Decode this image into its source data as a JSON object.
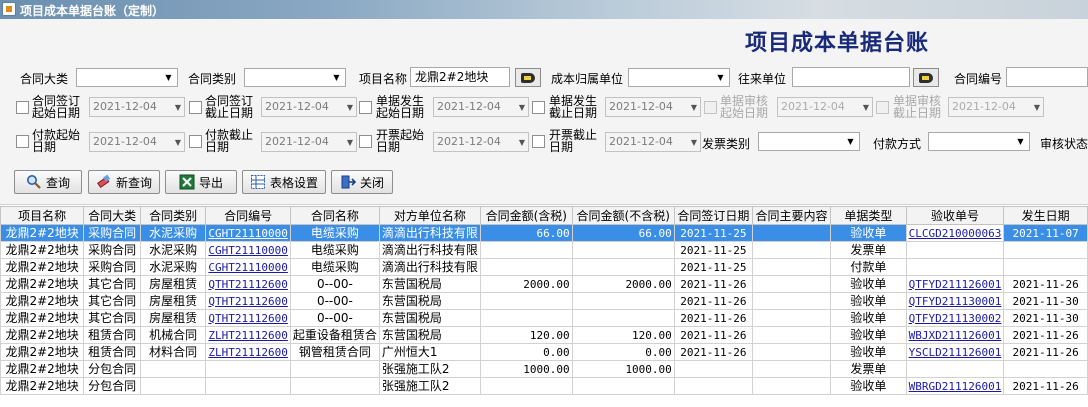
{
  "window": {
    "title": "项目成本单据台账（定制）"
  },
  "heading": "项目成本单据台账",
  "filters": {
    "contract_category_label": "合同大类",
    "contract_type_label": "合同类别",
    "project_name_label": "项目名称",
    "project_name_value": "龙鼎2#2地块",
    "cost_unit_label": "成本归属单位",
    "counterparty_label": "往来单位",
    "contract_no_label": "合同编号",
    "sign_start_label": "合同签订起始日期",
    "sign_end_label": "合同签订截止日期",
    "doc_start_label": "单据发生起始日期",
    "doc_end_label": "单据发生截止日期",
    "audit_start_label": "单据审核起始日期",
    "audit_end_label": "单据审核截止日期",
    "pay_start_label": "付款起始日期",
    "pay_end_label": "付款截止日期",
    "invoice_start_label": "开票起始日期",
    "invoice_end_label": "开票截止日期",
    "invoice_type_label": "发票类别",
    "pay_method_label": "付款方式",
    "audit_status_label": "审核状态",
    "date_value": "2021-12-04"
  },
  "buttons": {
    "query": "查询",
    "new_query": "新查询",
    "export": "导出",
    "table_settings": "表格设置",
    "close": "关闭"
  },
  "table": {
    "columns": [
      "项目名称",
      "合同大类",
      "合同类别",
      "合同编号",
      "合同名称",
      "对方单位名称",
      "合同金额(含税)",
      "合同金额(不含税)",
      "合同签订日期",
      "合同主要内容",
      "单据类型",
      "验收单号",
      "发生日期"
    ],
    "rows": [
      [
        "龙鼎2#2地块",
        "采购合同",
        "水泥采购",
        "CGHT21110000",
        "电缆采购",
        "滴滴出行科技有限",
        "66.00",
        "66.00",
        "2021-11-25",
        "",
        "验收单",
        "CLCGD210000063",
        "2021-11-07"
      ],
      [
        "龙鼎2#2地块",
        "采购合同",
        "水泥采购",
        "CGHT21110000",
        "电缆采购",
        "滴滴出行科技有限",
        "",
        "",
        "2021-11-25",
        "",
        "发票单",
        "",
        ""
      ],
      [
        "龙鼎2#2地块",
        "采购合同",
        "水泥采购",
        "CGHT21110000",
        "电缆采购",
        "滴滴出行科技有限",
        "",
        "",
        "2021-11-25",
        "",
        "付款单",
        "",
        ""
      ],
      [
        "龙鼎2#2地块",
        "其它合同",
        "房屋租赁",
        "QTHT21112600",
        "0--00-",
        "东营国税局",
        "2000.00",
        "2000.00",
        "2021-11-26",
        "",
        "验收单",
        "QTFYD211126001",
        "2021-11-26"
      ],
      [
        "龙鼎2#2地块",
        "其它合同",
        "房屋租赁",
        "QTHT21112600",
        "0--00-",
        "东营国税局",
        "",
        "",
        "2021-11-26",
        "",
        "验收单",
        "QTFYD211130001",
        "2021-11-30"
      ],
      [
        "龙鼎2#2地块",
        "其它合同",
        "房屋租赁",
        "QTHT21112600",
        "0--00-",
        "东营国税局",
        "",
        "",
        "2021-11-26",
        "",
        "验收单",
        "QTFYD211130002",
        "2021-11-30"
      ],
      [
        "龙鼎2#2地块",
        "租赁合同",
        "机械合同",
        "ZLHT21112600",
        "起重设备租赁合",
        "东营国税局",
        "120.00",
        "120.00",
        "2021-11-26",
        "",
        "验收单",
        "WBJXD211126001",
        "2021-11-26"
      ],
      [
        "龙鼎2#2地块",
        "租赁合同",
        "材料合同",
        "ZLHT21112600",
        "钢管租赁合同",
        "广州恒大1",
        "0.00",
        "0.00",
        "2021-11-26",
        "",
        "验收单",
        "YSCLD211126001",
        "2021-11-26"
      ],
      [
        "龙鼎2#2地块",
        "分包合同",
        "",
        "",
        "",
        "张强施工队2",
        "1000.00",
        "1000.00",
        "",
        "",
        "发票单",
        "",
        ""
      ],
      [
        "龙鼎2#2地块",
        "分包合同",
        "",
        "",
        "",
        "张强施工队2",
        "",
        "",
        "",
        "",
        "验收单",
        "WBRGD211126001",
        "2021-11-26"
      ]
    ]
  }
}
